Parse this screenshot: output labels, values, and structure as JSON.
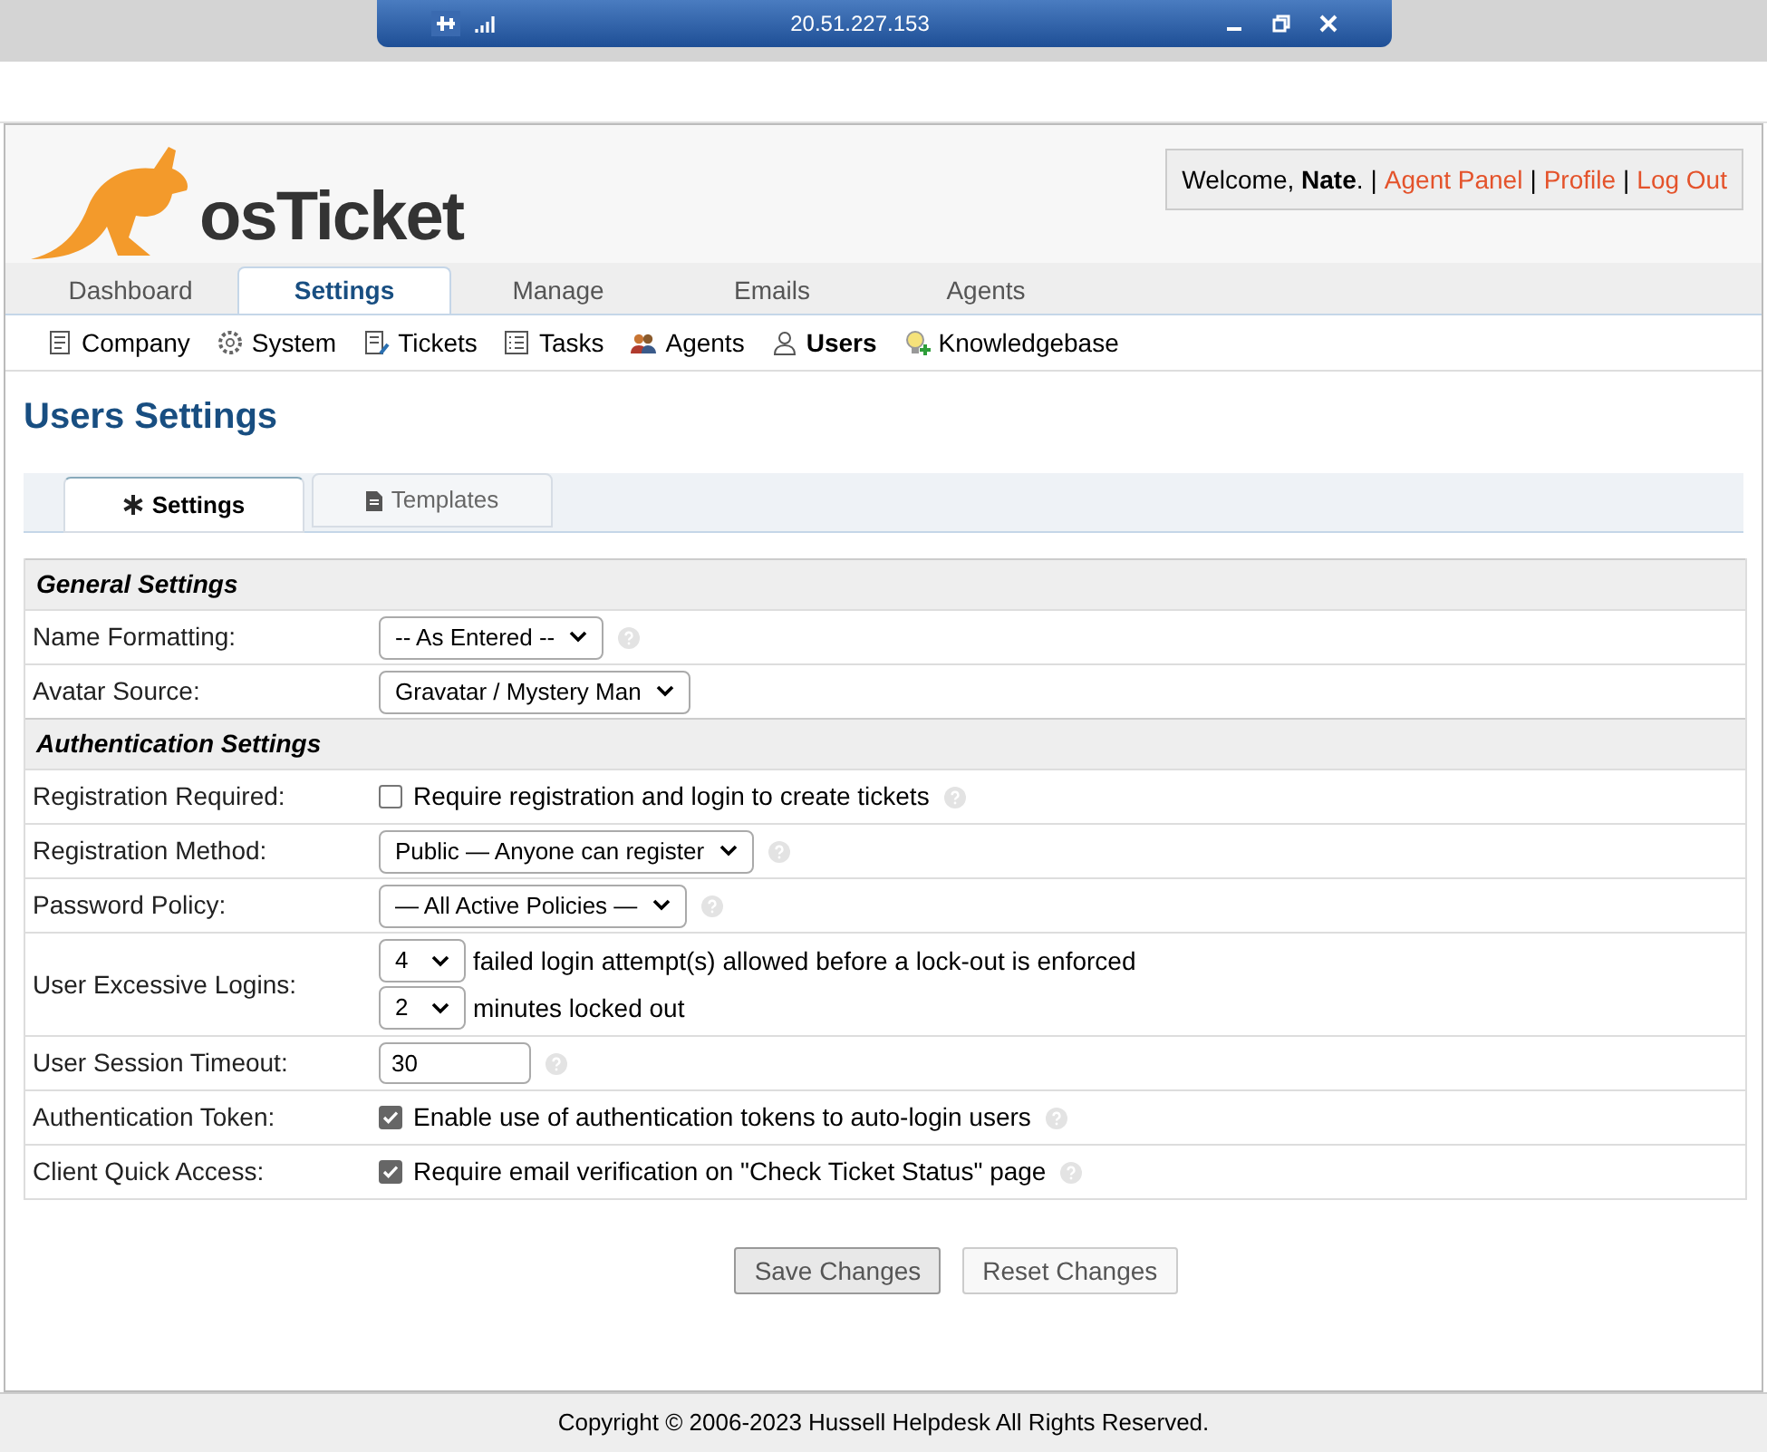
{
  "remote_bar": {
    "title": "20.51.227.153"
  },
  "logo": {
    "text": "osTicket"
  },
  "user_box": {
    "welcome": "Welcome, **Nate**.",
    "links": [
      {
        "separator": "|",
        "label": "Agent Panel"
      },
      {
        "separator": "|",
        "label": "Profile"
      },
      {
        "separator": "|",
        "label": "Log Out"
      }
    ]
  },
  "nav_tabs": [
    {
      "label": "Dashboard",
      "selected": false
    },
    {
      "label": "Settings",
      "selected": true
    },
    {
      "label": "Manage",
      "selected": false
    },
    {
      "label": "Emails",
      "selected": false
    },
    {
      "label": "Agents",
      "selected": false
    }
  ],
  "sub_nav": [
    {
      "label": "Company",
      "selected": false
    },
    {
      "label": "System",
      "selected": false
    },
    {
      "label": "Tickets",
      "selected": false
    },
    {
      "label": "Tasks",
      "selected": false
    },
    {
      "label": "Agents",
      "selected": false
    },
    {
      "label": "Users",
      "selected": true
    },
    {
      "label": "Knowledgebase",
      "selected": false
    }
  ],
  "page_title": "Users Settings",
  "page_tabs": [
    {
      "label": "Settings",
      "selected": true
    },
    {
      "label": "Templates",
      "selected": false
    }
  ],
  "sections": [
    {
      "title": "General Settings",
      "rows": [
        {
          "kind": "select",
          "label": "Name Formatting:",
          "value": "-- As Entered --",
          "help": true
        },
        {
          "kind": "select",
          "label": "Avatar Source:",
          "value": "Gravatar / Mystery Man",
          "help": false
        }
      ]
    },
    {
      "title": "Authentication Settings",
      "rows": [
        {
          "kind": "checkbox",
          "label": "Registration Required:",
          "text": "Require registration and login to create tickets",
          "checked": false,
          "help": true
        },
        {
          "kind": "select",
          "label": "Registration Method:",
          "value": "Public — Anyone can register",
          "help": true
        },
        {
          "kind": "select",
          "label": "Password Policy:",
          "value": "— All Active Policies —",
          "help": true
        },
        {
          "kind": "logins",
          "label": "User Excessive Logins:",
          "lines": [
            {
              "value": "4",
              "text": "failed login attempt(s) allowed before a lock-out is enforced"
            },
            {
              "value": "2",
              "text": "minutes locked out"
            }
          ],
          "help": false
        },
        {
          "kind": "text",
          "label": "User Session Timeout:",
          "value": "30",
          "help": true
        },
        {
          "kind": "checkbox",
          "label": "Authentication Token:",
          "text": "Enable use of authentication tokens to auto-login users",
          "checked": true,
          "help": true
        },
        {
          "kind": "checkbox",
          "label": "Client Quick Access:",
          "text": "Require email verification on \"Check Ticket Status\" page",
          "checked": true,
          "help": true
        }
      ]
    }
  ],
  "buttons": [
    {
      "label": "Save Changes",
      "kind": "primary"
    },
    {
      "label": "Reset Changes",
      "kind": "secondary"
    }
  ],
  "footer": "Copyright © 2006-2023 Hussell Helpdesk All Rights Reserved."
}
